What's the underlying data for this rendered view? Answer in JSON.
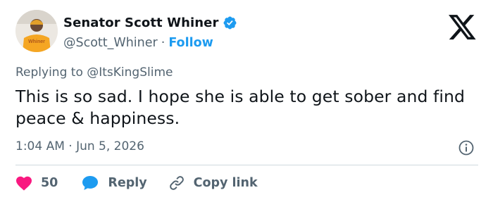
{
  "author": {
    "display_name": "Senator Scott Whiner",
    "handle": "@Scott_Whiner",
    "separator": "·",
    "follow_label": "Follow",
    "avatar_shirt_text": "Whiner",
    "verified": true
  },
  "reply_context": {
    "text": "Replying to @ItsKingSlime"
  },
  "tweet": {
    "text": "This is so sad. I hope she is able to get sober and find peace & happiness.",
    "timestamp": "1:04 AM · Jun 5, 2026"
  },
  "actions": {
    "like_count": "50",
    "reply_label": "Reply",
    "copy_link_label": "Copy link"
  },
  "colors": {
    "accent": "#1d9bf0",
    "like": "#f91880",
    "text_primary": "#0f1419",
    "text_secondary": "#536471",
    "divider": "#cfd9de",
    "avatar_shirt": "#f5a623"
  },
  "icons": {
    "brand": "x-logo-icon",
    "verified": "verified-badge-icon",
    "info": "info-icon",
    "like": "heart-icon",
    "reply": "speech-bubble-icon",
    "copy_link": "link-icon"
  }
}
